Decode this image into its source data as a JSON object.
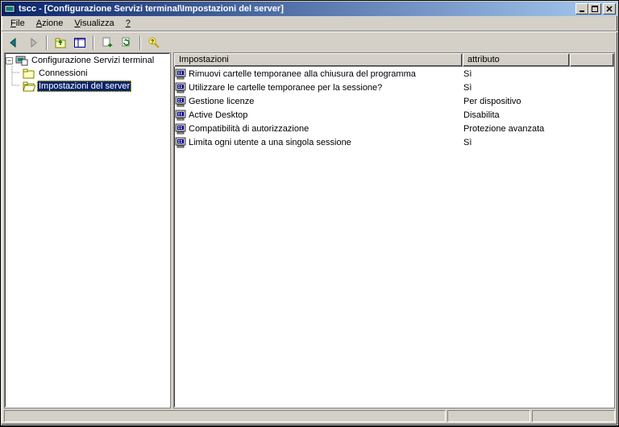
{
  "title": "tscc - [Configurazione Servizi terminal\\Impostazioni del server]",
  "menu": {
    "file": "File",
    "azione": "Azione",
    "visualizza": "Visualizza",
    "help": "?"
  },
  "tree": {
    "root": "Configurazione Servizi terminal",
    "conn": "Connessioni",
    "server": "Impostazioni del server"
  },
  "columns": {
    "settings": "Impostazioni",
    "attribute": "attributo"
  },
  "rows": [
    {
      "setting": "Rimuovi cartelle temporanee alla chiusura del programma",
      "attr": "Sì"
    },
    {
      "setting": "Utilizzare le cartelle temporanee per la sessione?",
      "attr": "Sì"
    },
    {
      "setting": "Gestione licenze",
      "attr": "Per dispositivo"
    },
    {
      "setting": "Active Desktop",
      "attr": "Disabilita"
    },
    {
      "setting": "Compatibilità di autorizzazione",
      "attr": "Protezione avanzata"
    },
    {
      "setting": "Limita ogni utente a una singola sessione",
      "attr": "Sì"
    }
  ],
  "col_widths": {
    "settings": 358,
    "attribute": 133,
    "extra": 54
  }
}
